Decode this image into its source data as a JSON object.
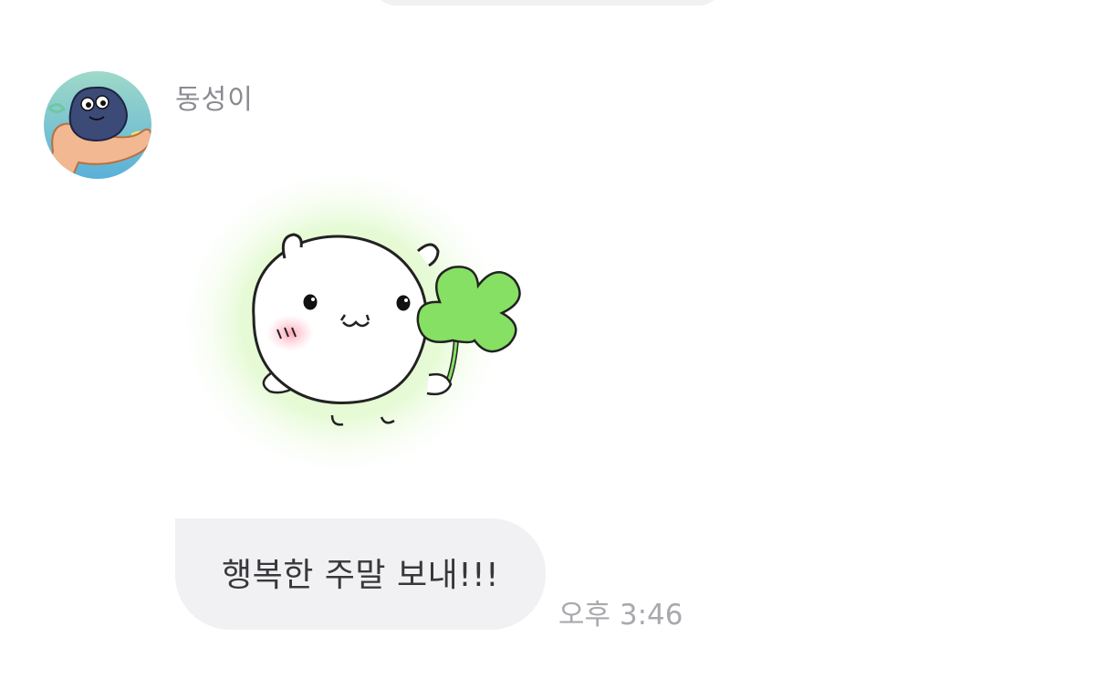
{
  "conversation": {
    "sender": {
      "name": "동성이",
      "avatar_icon": "rock-character-avatar-icon"
    },
    "sticker": {
      "icon": "white-hamster-clover-sticker-icon",
      "glow_color": "#d8f8c0"
    },
    "message": {
      "text": "행복한 주말 보내!!!",
      "timestamp": "오후 3:46"
    }
  },
  "colors": {
    "bubble": "#f1f1f3",
    "name_text": "#8a8b90",
    "message_text": "#38383c",
    "timestamp_text": "#a8a9ad",
    "clover": "#86e063"
  }
}
